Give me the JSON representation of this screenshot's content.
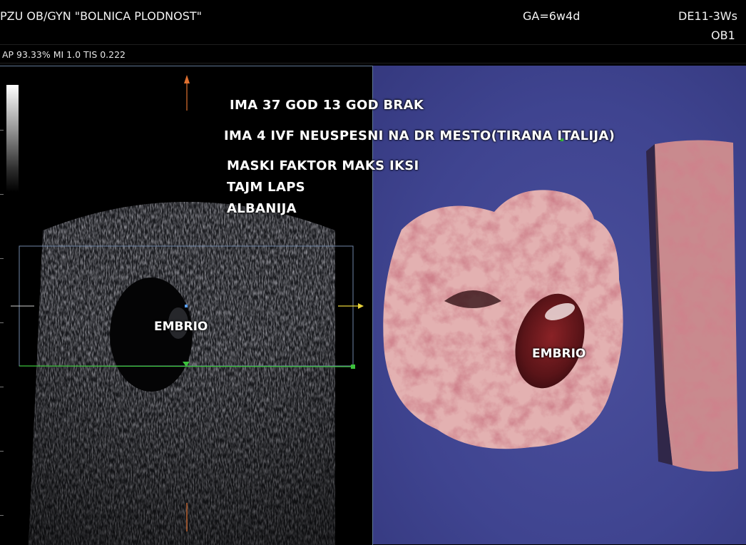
{
  "header": {
    "clinic": "PZU OB/GYN \"BOLNICA PLODNOST\"",
    "gestational_age": "GA=6w4d",
    "probe": "DE11-3Ws",
    "preset": "OB1"
  },
  "parameters": "AP 93.33%  MI 1.0 TIS 0.222",
  "annotations": [
    "IMA 37 GOD 13 GOD BRAK",
    "IMA 4 IVF NEUSPESNI NA DR MESTO(TIRANA ITALIJA)",
    "MASKI FAKTOR MAKS IKSI",
    "TAJM LAPS",
    "ALBANIJA"
  ],
  "labels": {
    "bmode_embrio": "EMBRIO",
    "render_embrio": "EMBRIO"
  },
  "colors": {
    "render_background": "#3f4490",
    "roi_box": "#6f86a8",
    "baseline_green": "#3cc23c",
    "arrow_orange": "#e07030",
    "arrow_yellow": "#e8d23a",
    "tissue_pink": "#e0a8a8"
  },
  "icons": [
    "grayscale-bar",
    "orange-orientation-arrow",
    "yellow-marker-arrow",
    "green-position-marker"
  ]
}
